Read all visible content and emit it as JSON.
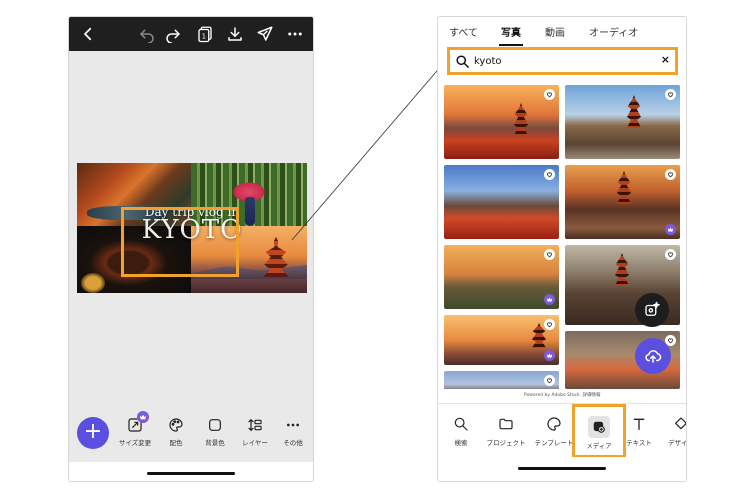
{
  "editor": {
    "canvas_subtitle": "Day trip vlog in",
    "canvas_title": "KYOTO",
    "toolbar": {
      "resize_label": "サイズ変更",
      "colors_label": "配色",
      "background_label": "背景色",
      "layers_label": "レイヤー",
      "more_label": "その他"
    }
  },
  "media_panel": {
    "tabs": [
      {
        "label": "すべて",
        "active": false
      },
      {
        "label": "写真",
        "active": true
      },
      {
        "label": "動画",
        "active": false
      },
      {
        "label": "オーディオ",
        "active": false
      }
    ],
    "search": {
      "value": "kyoto",
      "clear_label": "×"
    },
    "powered_by": "Powered by Adobe Stock. 詳細情報",
    "nav": {
      "search_label": "検索",
      "projects_label": "プロジェクト",
      "templates_label": "テンプレート",
      "media_label": "メディア",
      "text_label": "テキスト",
      "design_label": "デザイン"
    }
  },
  "colors": {
    "accent": "#5b4fe0",
    "highlight": "#f2a12c",
    "premium": "#7d5ad8",
    "topbar": "#1f1f1f"
  }
}
